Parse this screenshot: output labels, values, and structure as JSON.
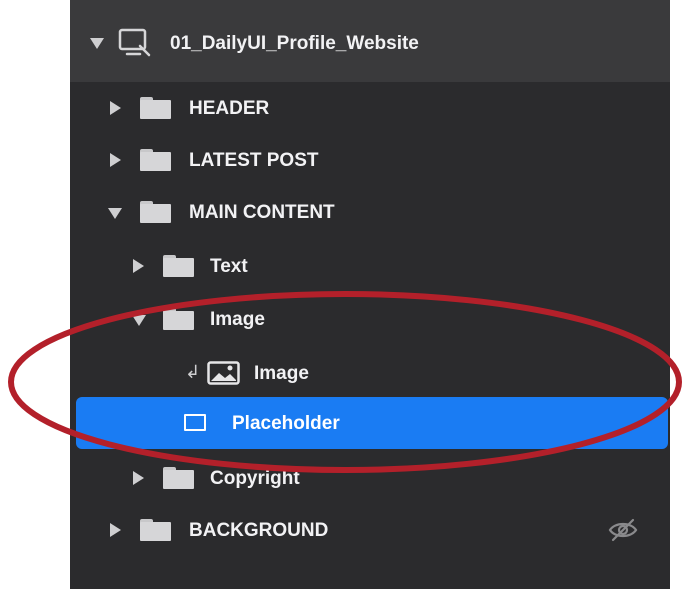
{
  "artboard": {
    "title": "01_DailyUI_Profile_Website",
    "expanded": true,
    "icon": "artboard-icon"
  },
  "layers": [
    {
      "key": "header",
      "label": "HEADER",
      "type": "group",
      "disclosure": "collapsed",
      "depth": 0
    },
    {
      "key": "latest_post",
      "label": "LATEST POST",
      "type": "group",
      "disclosure": "collapsed",
      "depth": 0
    },
    {
      "key": "main_content",
      "label": "MAIN CONTENT",
      "type": "group",
      "disclosure": "expanded",
      "depth": 0
    },
    {
      "key": "text",
      "label": "Text",
      "type": "group",
      "disclosure": "collapsed",
      "depth": 1
    },
    {
      "key": "image_group",
      "label": "Image",
      "type": "group",
      "disclosure": "expanded",
      "depth": 1
    },
    {
      "key": "image_layer",
      "label": "Image",
      "type": "image",
      "masked": true,
      "depth": 2
    },
    {
      "key": "placeholder",
      "label": "Placeholder",
      "type": "rectangle",
      "selected": true,
      "depth": 2
    },
    {
      "key": "copyright",
      "label": "Copyright",
      "type": "group",
      "disclosure": "collapsed",
      "depth": 1
    },
    {
      "key": "background",
      "label": "BACKGROUND",
      "type": "group",
      "disclosure": "collapsed",
      "depth": 0,
      "hidden": true
    }
  ],
  "colors": {
    "panel_bg": "#2b2b2d",
    "header_bg": "#3a3a3c",
    "selection": "#1a7cf3",
    "text": "#f2f2f4",
    "annotation": "#b3202a"
  },
  "annotation": {
    "shape": "ellipse",
    "highlights": [
      "image_group",
      "image_layer",
      "placeholder"
    ]
  }
}
